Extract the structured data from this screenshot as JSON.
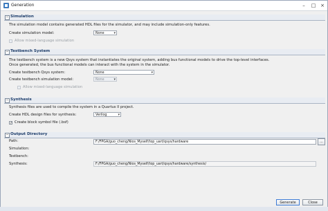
{
  "window": {
    "title": "Generation"
  },
  "simulation": {
    "header": "Simulation",
    "description": "The simulation model contains generated HDL files for the simulator, and may include simulation-only features.",
    "create_model_label": "Create simulation model:",
    "create_model_value": "None",
    "mixed_label": "Allow mixed-language simulation"
  },
  "testbench": {
    "header": "Testbench System",
    "description_line1": "The testbench system is a new Qsys system that instantiates the original system, adding bus functional models to drive the top-level interfaces.",
    "description_line2": "Once generated, the bus functional models can interact with the system in the simulator.",
    "qsys_label": "Create testbench Qsys system:",
    "qsys_value": "None",
    "model_label": "Create testbench simulation model:",
    "model_value": "None",
    "mixed_label": "Allow mixed-language simulation"
  },
  "synthesis": {
    "header": "Synthesis",
    "description": "Synthesis files are used to compile the system in a Quartus II project.",
    "hdl_label": "Create HDL design files for synthesis:",
    "hdl_value": "Verilog",
    "bsf_label": "Create block symbol file (.bsf)",
    "bsf_checked": "✓"
  },
  "output": {
    "header": "Output Directory",
    "path_label": "Path:",
    "path_value": "F:/FPGA/guo_cheng/Nios_Myself/top_uart/qsys/hardware",
    "browse_label": "...",
    "simulation_label": "Simulation:",
    "simulation_value": "",
    "testbench_label": "Testbench:",
    "testbench_value": "",
    "synthesis_label": "Synthesis:",
    "synthesis_value": "F:/FPGA/guo_cheng/Nios_Myself/top_uart/qsys/hardware/synthesis/"
  },
  "footer": {
    "generate_label": "Generate",
    "close_label": "Close"
  },
  "icons": {
    "collapse": "minus-box-icon",
    "dropdown": "chevron-down-icon"
  }
}
